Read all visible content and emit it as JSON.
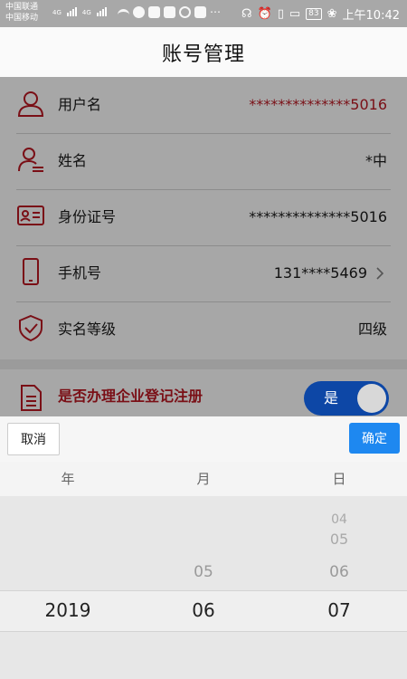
{
  "status_bar": {
    "carrier1": "中国联通",
    "carrier2": "中国移动",
    "net1": "4G",
    "net2": "4G",
    "battery": "83",
    "time": "上午10:42"
  },
  "header": {
    "title": "账号管理"
  },
  "rows": [
    {
      "label": "用户名",
      "value": "**************5016",
      "icon": "user-icon"
    },
    {
      "label": "姓名",
      "value": "*中",
      "icon": "person-name-icon"
    },
    {
      "label": "身份证号",
      "value": "**************5016",
      "icon": "id-card-icon"
    },
    {
      "label": "手机号",
      "value": "131****5469",
      "icon": "phone-icon"
    },
    {
      "label": "实名等级",
      "value": "四级",
      "icon": "shield-check-icon"
    }
  ],
  "enterprise": {
    "label": "是否办理企业登记注册",
    "toggle_text": "是",
    "icon": "document-icon"
  },
  "picker": {
    "cancel": "取消",
    "confirm": "确定",
    "columns": [
      "年",
      "月",
      "日"
    ],
    "year": {
      "selected": "2019"
    },
    "month": {
      "above": "05",
      "selected": "06"
    },
    "day": {
      "above3": "04",
      "above2": "05",
      "above1": "06",
      "selected": "07"
    }
  },
  "colors": {
    "accent": "#7a0f16",
    "confirm_button": "#1e88f0",
    "toggle_bg": "#0d47a6"
  }
}
